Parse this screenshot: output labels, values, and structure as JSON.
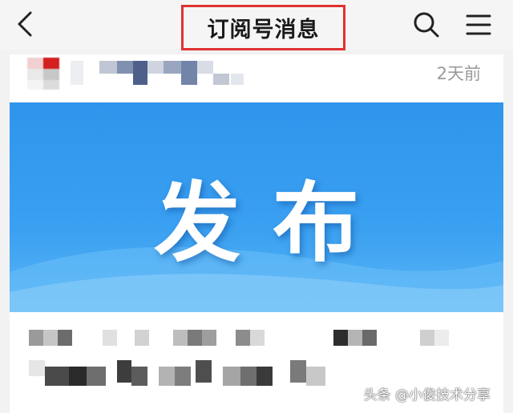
{
  "header": {
    "title": "订阅号消息",
    "back_icon": "chevron-left-icon",
    "search_icon": "search-icon",
    "menu_icon": "menu-icon"
  },
  "card": {
    "timestamp": "2天前",
    "banner_text": "发布",
    "banner_color": "#2f95ec"
  },
  "watermark": "头条 @小俊技术分享",
  "colors": {
    "highlight_border": "#e03131"
  }
}
